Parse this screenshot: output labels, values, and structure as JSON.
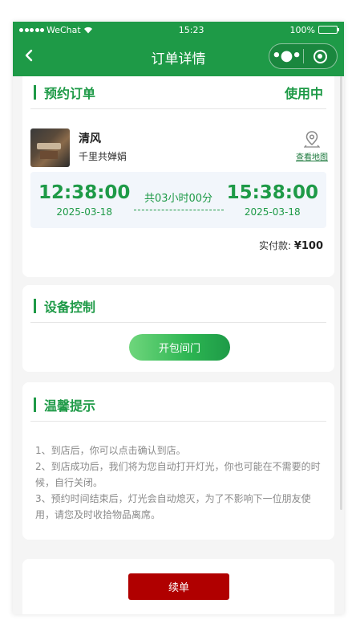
{
  "status_bar": {
    "carrier": "WeChat",
    "time": "15:23",
    "battery": "100%"
  },
  "nav": {
    "back_icon": "chevron-left-icon",
    "title": "订单详情",
    "more_icon": "more-dots-icon",
    "close_icon": "target-close-icon"
  },
  "order": {
    "section_title": "预约订单",
    "status": "使用中",
    "store_name": "清风",
    "store_address": "千里共婵娟",
    "map_link": "查看地图",
    "start_time": "12:38:00",
    "start_date": "2025-03-18",
    "duration": "共03小时00分",
    "end_time": "15:38:00",
    "end_date": "2025-03-18",
    "paid_label": "实付款:",
    "paid_amount": "¥100"
  },
  "device": {
    "section_title": "设备控制",
    "open_button": "开包间门"
  },
  "tips": {
    "section_title": "温馨提示",
    "items": [
      "1、到店后，你可以点击确认到店。",
      "2、到店成功后，我们将为您自动打开灯光，你也可能在不需要的时候，自行关闭。",
      "3、预约时间结束后，灯光会自动熄灭，为了不影响下一位朋友使用，请您及时收拾物品离席。"
    ]
  },
  "footer": {
    "renew_button": "续单"
  },
  "colors": {
    "primary": "#1e9a47",
    "renew": "#b00000",
    "time_box_bg": "#f2f6fb"
  }
}
